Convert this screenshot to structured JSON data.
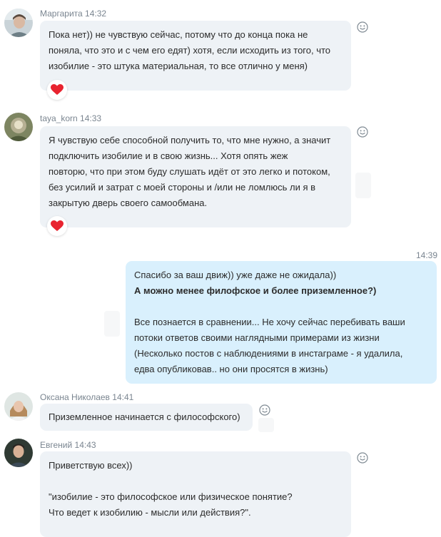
{
  "colors": {
    "incoming_bubble": "#eef2f6",
    "outgoing_bubble": "#d9f0fd",
    "meta_text": "#7a8590",
    "heart": "#e8232f"
  },
  "messages": [
    {
      "id": "m1",
      "author": "Маргарита",
      "time": "14:32",
      "text": "Пока нет)) не чувствую сейчас, потому что до конца пока не\nпоняла, что это и с чем его едят) хотя, если исходить из того, что\nизобилие - это штука материальная, то все отлично у меня)",
      "reaction": "heart-icon"
    },
    {
      "id": "m2",
      "author": "taya_korn",
      "time": "14:33",
      "text": "Я чувствую себе способной получить то, что мне нужно, а значит\nподключить изобилие и в свою жизнь... Хотя опять жеж\nповторю, что при этом буду слушать идёт от это легко и потоком,\nбез усилий и затрат с моей стороны и /или не ломлюсь ли я в\nзакрытую дверь своего самообмана.",
      "reaction": "heart-icon"
    },
    {
      "id": "m3",
      "own": true,
      "time": "14:39",
      "line1": "Спасибо за ваш движ)) уже даже не ожидала))",
      "line2_bold": "А можно менее филофское и более приземленное?)",
      "paragraph": "Все познается в сравнении... Не хочу сейчас перебивать ваши\nпотоки ответов своими наглядными примерами из жизни\n(Несколько постов с наблюдениями в инстаграме - я удалила,\nедва опубликовав.. но они просятся в жизнь)"
    },
    {
      "id": "m4",
      "author": "Оксана Николаев",
      "time": "14:41",
      "text": "Приземленное начинается с философского)"
    },
    {
      "id": "m5",
      "author": "Евгений",
      "time": "14:43",
      "line1": "Приветствую всех))",
      "quote": " \"изобилие - это философское или физическое понятие?\nЧто ведет к изобилию - мысли или действия?\"."
    }
  ]
}
